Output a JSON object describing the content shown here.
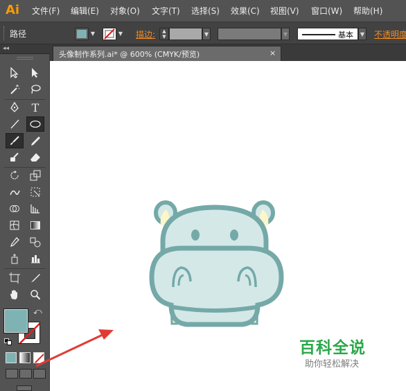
{
  "app": {
    "logo_text": "Ai",
    "brand_color": "#ff9a00"
  },
  "menu": {
    "items": [
      {
        "label": "文件(F)"
      },
      {
        "label": "编辑(E)"
      },
      {
        "label": "对象(O)"
      },
      {
        "label": "文字(T)"
      },
      {
        "label": "选择(S)"
      },
      {
        "label": "效果(C)"
      },
      {
        "label": "视图(V)"
      },
      {
        "label": "窗口(W)"
      },
      {
        "label": "帮助(H)"
      }
    ]
  },
  "control_bar": {
    "selection_label": "路径",
    "fill_color": "#7fb3b3",
    "stroke_label": "描边:",
    "stroke_style_label": "基本",
    "opacity_label": "不透明度"
  },
  "document": {
    "tab_title": "头像制作系列.ai* @ 600% (CMYK/预览)",
    "close_glyph": "×"
  },
  "tools": {
    "fill_color": "#7fb3b3"
  },
  "colors": {
    "hippo_fill": "#d4e8e8",
    "hippo_stroke": "#74a9a8",
    "ear_inner": "#fdf6c9",
    "feature": "#74a9a8",
    "arrow": "#e03c35"
  },
  "watermark": {
    "title": "百科全说",
    "subtitle": "助你轻松解决"
  }
}
